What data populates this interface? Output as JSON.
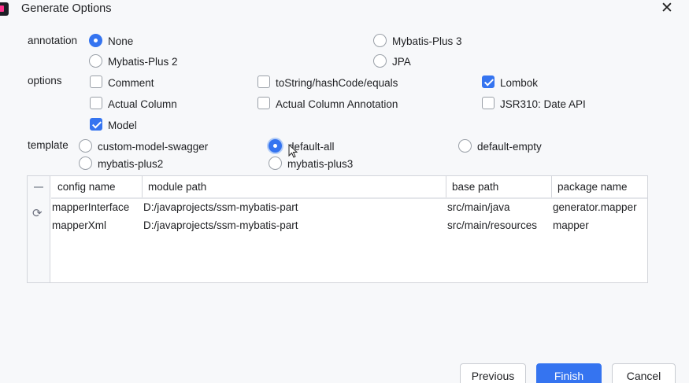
{
  "window": {
    "title": "Generate Options"
  },
  "annotation": {
    "label": "annotation",
    "options": [
      "None",
      "Mybatis-Plus 3",
      "Mybatis-Plus 2",
      "JPA"
    ],
    "selected": "None"
  },
  "options": {
    "label": "options",
    "items": [
      "Comment",
      "toString/hashCode/equals",
      "Lombok",
      "Actual Column",
      "Actual Column Annotation",
      "JSR310: Date API",
      "Model"
    ],
    "checked": [
      "Lombok",
      "Model"
    ]
  },
  "template": {
    "label": "template",
    "options": [
      "custom-model-swagger",
      "default-all",
      "default-empty",
      "mybatis-plus2",
      "mybatis-plus3"
    ],
    "selected": "default-all"
  },
  "table": {
    "columns": [
      "config name",
      "module path",
      "base path",
      "package name"
    ],
    "rows": [
      [
        "mapperInterface",
        "D:/javaprojects/ssm-mybatis-part",
        "src/main/java",
        "generator.mapper"
      ],
      [
        "mapperXml",
        "D:/javaprojects/ssm-mybatis-part",
        "src/main/resources",
        "mapper"
      ]
    ]
  },
  "buttons": {
    "previous": "Previous",
    "finish": "Finish",
    "cancel": "Cancel"
  },
  "colors": {
    "accent": "#3574f0",
    "background": "#f7f8fa"
  }
}
